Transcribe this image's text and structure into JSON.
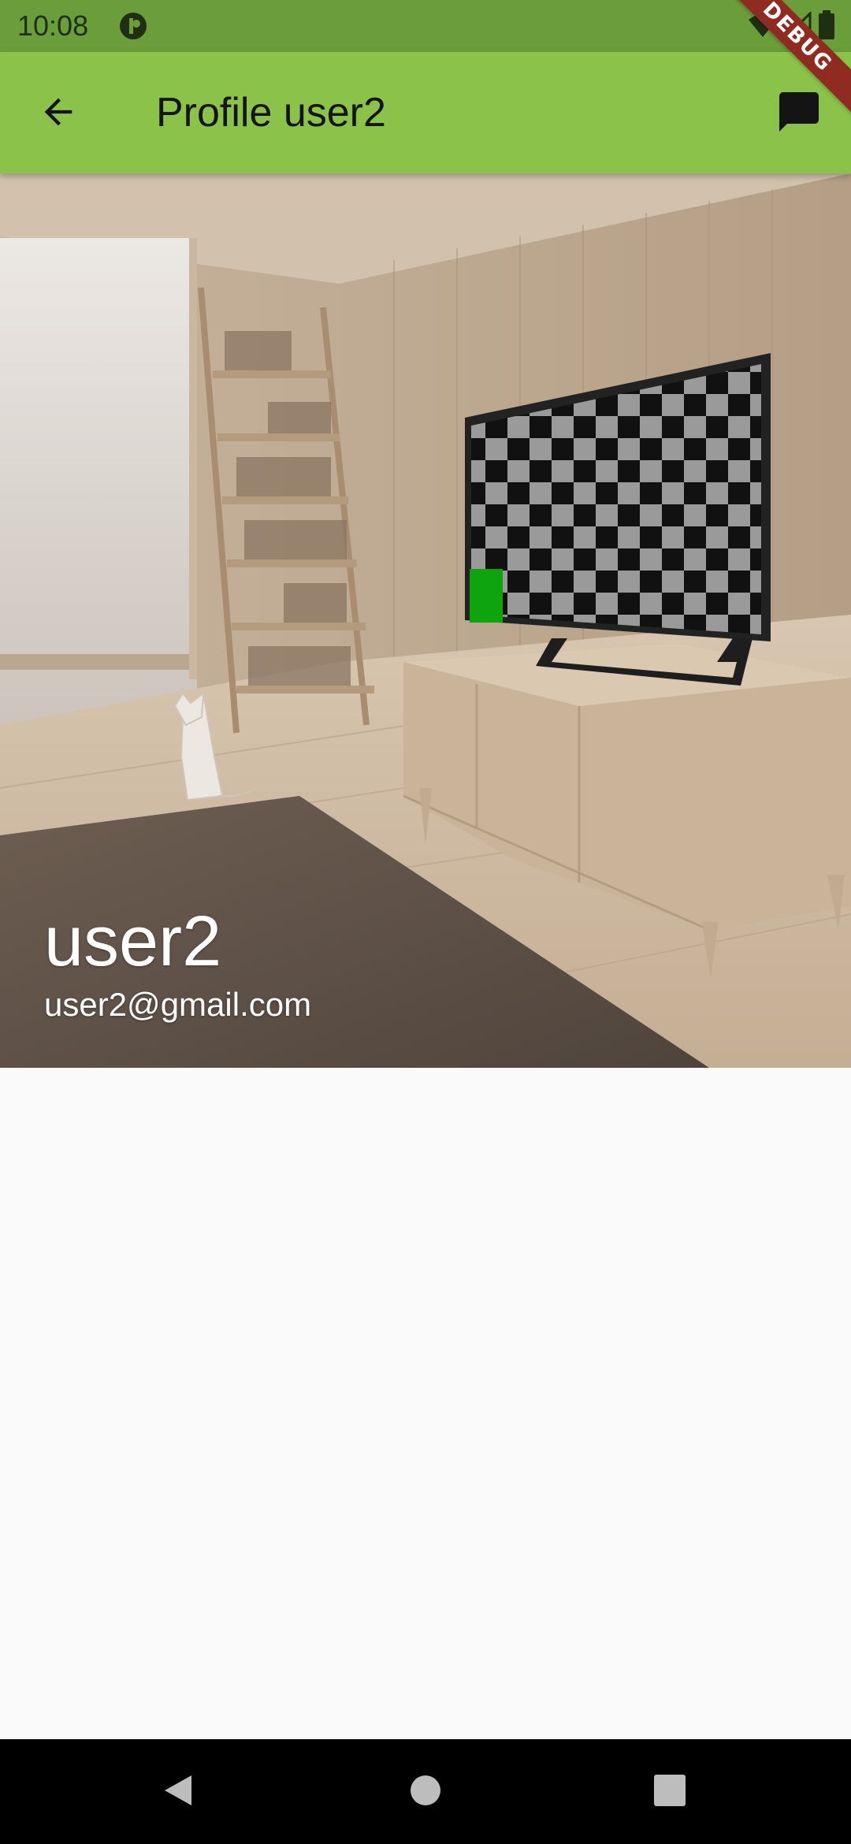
{
  "status_bar": {
    "time": "10:08",
    "background": "#6b9e3a",
    "icons": [
      "app-notification-icon",
      "wifi-icon",
      "signal-icon",
      "battery-icon"
    ]
  },
  "debug_banner": {
    "label": "DEBUG",
    "color": "#8f2b20"
  },
  "app_bar": {
    "title": "Profile user2",
    "background": "#8bc34a",
    "leading_icon": "arrow-back-icon",
    "action_icon": "message-icon"
  },
  "profile": {
    "name": "user2",
    "email": "user2@gmail.com",
    "header_image": "living-room-photo"
  },
  "navigation_bar": {
    "buttons": [
      "back-triangle-icon",
      "home-circle-icon",
      "recents-square-icon"
    ]
  }
}
